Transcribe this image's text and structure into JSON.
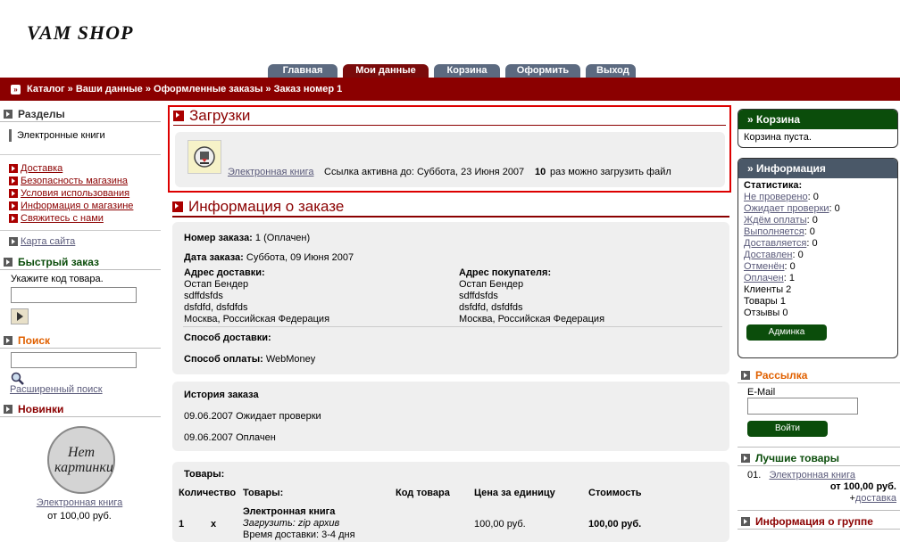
{
  "logo": "VAM SHOP",
  "tabs": [
    "Главная",
    "Мои данные",
    "Корзина",
    "Оформить",
    "Выход"
  ],
  "breadcrumb": "Каталог » Ваши данные » Оформленные заказы » Заказ номер 1",
  "left": {
    "sections_title": "Разделы",
    "category": "Электронные книги",
    "info_links": [
      "Доставка",
      "Безопасность магазина",
      "Условия использования",
      "Информация о магазине",
      "Свяжитесь с нами"
    ],
    "sitemap": "Карта сайта",
    "quick_order_title": "Быстрый заказ",
    "quick_order_hint": "Укажите код товара.",
    "search_title": "Поиск",
    "advanced_search": "Расширенный поиск",
    "news_title": "Новинки",
    "no_image": "Нет картинки",
    "news_item": "Электронная книга",
    "news_price": "от 100,00 руб."
  },
  "downloads": {
    "title": "Загрузки",
    "item": "Электронная книга",
    "valid_until": "Ссылка активна до: Суббота, 23 Июня 2007",
    "count": "10",
    "count_text": "раз можно загрузить файл"
  },
  "order": {
    "title": "Информация о заказе",
    "number_label": "Номер заказа:",
    "number_value": "1 (Оплачен)",
    "date_label": "Дата заказа:",
    "date_value": "Суббота, 09 Июня 2007",
    "delivery_address_label": "Адрес доставки:",
    "delivery_address": [
      "Остап Бендер",
      "sdffdsfds",
      "dsfdfd, dsfdfds",
      "Москва, Российская Федерация"
    ],
    "buyer_address_label": "Адрес покупателя:",
    "buyer_address": [
      "Остап Бендер",
      "sdffdsfds",
      "dsfdfd, dsfdfds",
      "Москва, Российская Федерация"
    ],
    "shipping_label": "Способ доставки:",
    "payment_label": "Способ оплаты:",
    "payment_value": "WebMoney"
  },
  "history": {
    "title": "История заказа",
    "rows": [
      "09.06.2007 Ожидает проверки",
      "09.06.2007 Оплачен"
    ]
  },
  "products": {
    "title": "Товары:",
    "headers": [
      "Количество",
      "Товары:",
      "Код товара",
      "Цена за единицу",
      "Стоимость"
    ],
    "row": {
      "qty": "1",
      "x": "x",
      "name": "Электронная книга",
      "sub1": "Загрузить: zip архив",
      "sub2": "Время доставки: 3-4 дня",
      "price": "100,00 руб.",
      "total": "100,00 руб."
    }
  },
  "right": {
    "cart_title": "» Корзина",
    "cart_empty": "Корзина пуста.",
    "info_title": "» Информация",
    "stats_label": "Статистика:",
    "stats": [
      {
        "label": "Не проверено",
        "value": "0",
        "link": true
      },
      {
        "label": "Ожидает проверки",
        "value": "0",
        "link": true
      },
      {
        "label": "Ждём оплаты",
        "value": "0",
        "link": true
      },
      {
        "label": "Выполняется",
        "value": "0",
        "link": true
      },
      {
        "label": "Доставляется",
        "value": "0",
        "link": true
      },
      {
        "label": "Доставлен",
        "value": "0",
        "link": true
      },
      {
        "label": "Отменён",
        "value": "0",
        "link": true
      },
      {
        "label": "Оплачен",
        "value": "1",
        "link": true
      },
      {
        "label": "Клиенты",
        "value": "2",
        "link": false
      },
      {
        "label": "Товары",
        "value": "1",
        "link": false
      },
      {
        "label": "Отзывы",
        "value": "0",
        "link": false
      }
    ],
    "admin_button": "Админка",
    "newsletter_title": "Рассылка",
    "email_label": "E-Mail",
    "login_button": "Войти",
    "best_title": "Лучшие товары",
    "best_num": "01.",
    "best_item": "Электронная книга",
    "best_price": "от 100,00 руб.",
    "best_delivery": "доставка",
    "group_title": "Информация о группе"
  },
  "colors": {
    "accent": "#8b0000",
    "tab": "#5c6a80",
    "green": "#0b4d0b",
    "slate": "#4a5868"
  }
}
